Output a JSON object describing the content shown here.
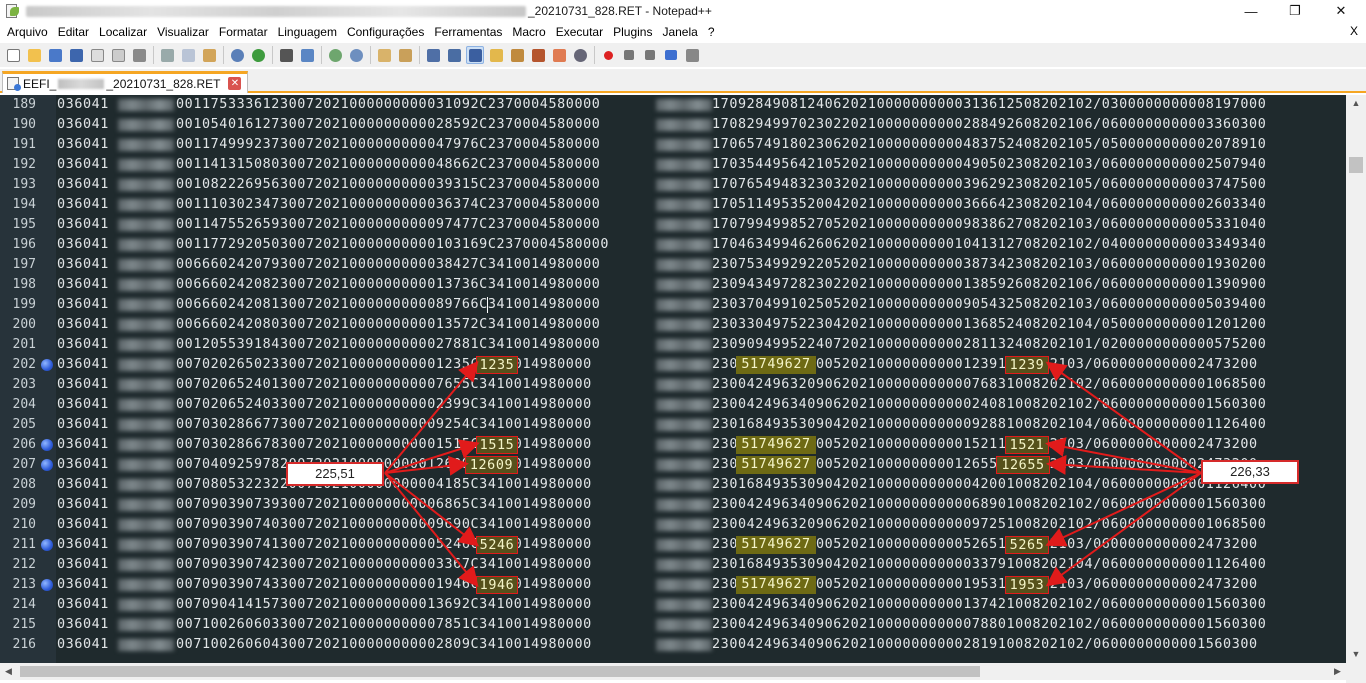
{
  "window": {
    "title": "_20210731_828.RET - Notepad++",
    "minimize": "—",
    "maximize": "❐",
    "close": "✕"
  },
  "menu": {
    "items": [
      "Arquivo",
      "Editar",
      "Localizar",
      "Visualizar",
      "Formatar",
      "Linguagem",
      "Configurações",
      "Ferramentas",
      "Macro",
      "Executar",
      "Plugins",
      "Janela",
      "?"
    ],
    "close": "X"
  },
  "tab": {
    "prefix": "EEFI_",
    "suffix": "_20210731_828.RET",
    "close": "✕"
  },
  "editor": {
    "lines": [
      {
        "n": "189",
        "a": "036041",
        "b": "0011753336123007202100000000003109 2C2370004580000",
        "c": "17092849081240620210000000000313612508202102/0300000000008197000"
      },
      {
        "n": "190",
        "a": "036041",
        "b": "001054016127300720210000000000285 92C2370004580000",
        "c": "17082949970230220210000000000288492608202106/0600000000003360300"
      },
      {
        "n": "191",
        "a": "036041",
        "b": "0011749992373007202100000000004797 6C2370004580000",
        "c": "17065749180230620210000000000483752408202105/0500000000002078910"
      },
      {
        "n": "192",
        "a": "036041",
        "b": "0011413150803007202100000000004866 2C2370004580000",
        "c": "17035449564210520210000000000490502308202103/0600000000002507940"
      },
      {
        "n": "193",
        "a": "036041",
        "b": "0010822269563007202100000000003931 5C2370004580000",
        "c": "17076549483230320210000000000396292308202105/0600000000003747500"
      },
      {
        "n": "194",
        "a": "036041",
        "b": "0011103023473007202100000000003637 4C2370004580000",
        "c": "17051149535200420210000000000366642308202104/0600000000002603340"
      },
      {
        "n": "195",
        "a": "036041",
        "b": "0011475526593007202100000000009747 7C2370004580000",
        "c": "17079949985270520210000000000983862708202103/0600000000005331040"
      },
      {
        "n": "196",
        "a": "036041",
        "b": "001177292050300720210000000000103169C2370004580000",
        "c": "17046349946260620210000000001041312708202102/0400000000003349340"
      },
      {
        "n": "197",
        "a": "036041",
        "b": "0066602420793007202100000000003842 7C3410014980000",
        "c": "23075349929220520210000000000387342308202103/0600000000001930200"
      },
      {
        "n": "198",
        "a": "036041",
        "b": "0066602420823007202100000000001373 6C3410014980000",
        "c": "23094349728230220210000000000138592608202106/0600000000001390900"
      },
      {
        "n": "199",
        "a": "036041",
        "b": "0066602420813007202100000000008976 6C3410014980000",
        "c": "23037049910250520210000000000905432508202103/0600000000005039400"
      },
      {
        "n": "200",
        "a": "036041",
        "b": "0066602420803007202100000000001357 2C3410014980000",
        "c": "23033049752230420210000000000136852408202104/0500000000001201200"
      },
      {
        "n": "201",
        "a": "036041",
        "b": "0012055391843007202100000000002788 1C3410014980000",
        "c": "23090949952240720210000000000281132408202101/0200000000000575200"
      },
      {
        "n": "202",
        "a": "036041",
        "b": "0070202650233007202100000000001235C3410014980000",
        "c": "2305174962710052021000000000012391008202103/0600000000002473200",
        "bm": true
      },
      {
        "n": "203",
        "a": "036041",
        "b": "0070206524013007202100000000007655C3410014980000",
        "c": "23004249632090620210000000000076831008202102/0600000000001068500"
      },
      {
        "n": "204",
        "a": "036041",
        "b": "0070206524033007202100000000002399C3410014980000",
        "c": "23004249634090620210000000000024081008202102/0600000000001560300"
      },
      {
        "n": "205",
        "a": "036041",
        "b": "0070302866773007202100000000009254C3410014980000",
        "c": "23016849353090420210000000000092881008202104/0600000000001126400"
      },
      {
        "n": "206",
        "a": "036041",
        "b": "0070302866783007202100000000001515C3410014980000",
        "c": "2305174962710052021000000000015211008202103/0600000000002473200",
        "bm": true
      },
      {
        "n": "207",
        "a": "036041",
        "b": "0070409259782007202100000000012609C3410014980000",
        "c": "2305174962710052021000000000126551008202103/0600000000002473200",
        "bm": true
      },
      {
        "n": "208",
        "a": "036041",
        "b": "0070805322322007202100000000004185C3410014980000",
        "c": "23016849353090420210000000000042001008202104/0600000000001126400"
      },
      {
        "n": "209",
        "a": "036041",
        "b": "0070903907393007202100000000006865C3410014980000",
        "c": "23004249634090620210000000000068901008202102/0600000000001560300"
      },
      {
        "n": "210",
        "a": "036041",
        "b": "0070903907403007202100000000009690C3410014980000",
        "c": "23004249632090620210000000000097251008202102/0600000000001068500"
      },
      {
        "n": "211",
        "a": "036041",
        "b": "0070903907413007202100000000005246C3410014980000",
        "c": "2305174962710052021000000000052651008202103/0600000000002473200",
        "bm": true
      },
      {
        "n": "212",
        "a": "036041",
        "b": "0070903907423007202100000000003367C3410014980000",
        "c": "23016849353090420210000000000033791008202104/0600000000001126400"
      },
      {
        "n": "213",
        "a": "036041",
        "b": "0070903907433007202100000000001946C3410014980000",
        "c": "2305174962710052021000000000019531008202103/0600000000002473200",
        "bm": true
      },
      {
        "n": "214",
        "a": "036041",
        "b": "0070904141573007202100000000013692C3410014980000",
        "c": "23004249634090620210000000000137421008202102/0600000000001560300"
      },
      {
        "n": "215",
        "a": "036041",
        "b": "0071002606033007202100000000007851C3410014980000",
        "c": "23004249634090620210000000000078801008202102/0600000000001560300"
      },
      {
        "n": "216",
        "a": "036041",
        "b": "0071002606043007202100000000002809C3410014980000",
        "c": "23004249634090620210000000000281910082021 02/0600000000001560300"
      }
    ],
    "highlights_left": [
      "1235",
      "1515",
      "12609",
      "5246",
      "1946"
    ],
    "highlights_right": [
      "1239",
      "1521",
      "12655",
      "5265",
      "1953"
    ],
    "highlight_middle": "51749627"
  },
  "callouts": {
    "left_total": "225,51",
    "right_total": "226,33"
  },
  "colors": {
    "editor_bg": "#1f2a2d",
    "highlight_border": "#e11b1b",
    "highlight_fill": "#6e6a14",
    "arrow": "#e11b1b",
    "tab_accent": "#f5a623"
  }
}
